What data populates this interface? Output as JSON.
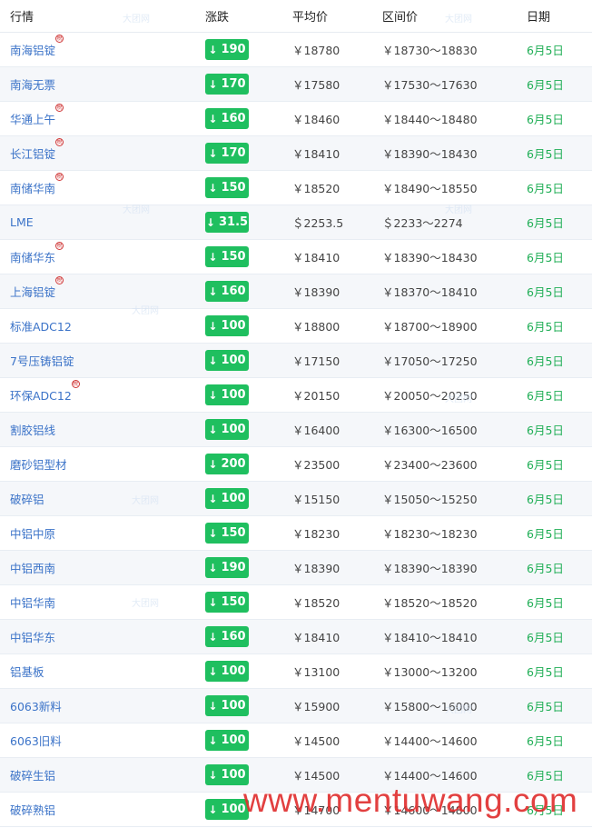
{
  "headers": {
    "name": "行情",
    "change": "涨跌",
    "avg": "平均价",
    "range": "区间价",
    "date": "日期"
  },
  "badge_glyph": "税",
  "arrow_glyph": "↓",
  "watermark_text": "www.mentuwang.com",
  "faint_logo_text": "大团网",
  "colors": {
    "up_down_pill": "#1fbf5f",
    "date_text": "#1fae55",
    "link_text": "#3b73c8",
    "watermark": "#e03030"
  },
  "rows": [
    {
      "name": "南海铝锭",
      "badge": true,
      "change": "190",
      "avg": "￥18780",
      "range": "￥18730～18830",
      "date": "6月5日"
    },
    {
      "name": "南海无票",
      "badge": false,
      "change": "170",
      "avg": "￥17580",
      "range": "￥17530～17630",
      "date": "6月5日"
    },
    {
      "name": "华通上午",
      "badge": true,
      "change": "160",
      "avg": "￥18460",
      "range": "￥18440～18480",
      "date": "6月5日"
    },
    {
      "name": "长江铝锭",
      "badge": true,
      "change": "170",
      "avg": "￥18410",
      "range": "￥18390～18430",
      "date": "6月5日"
    },
    {
      "name": "南储华南",
      "badge": true,
      "change": "150",
      "avg": "￥18520",
      "range": "￥18490～18550",
      "date": "6月5日"
    },
    {
      "name": "LME",
      "badge": false,
      "change": "31.5",
      "avg": "＄2253.5",
      "range": "＄2233～2274",
      "date": "6月5日"
    },
    {
      "name": "南储华东",
      "badge": true,
      "change": "150",
      "avg": "￥18410",
      "range": "￥18390～18430",
      "date": "6月5日"
    },
    {
      "name": "上海铝锭",
      "badge": true,
      "change": "160",
      "avg": "￥18390",
      "range": "￥18370～18410",
      "date": "6月5日"
    },
    {
      "name": "标准ADC12",
      "badge": false,
      "change": "100",
      "avg": "￥18800",
      "range": "￥18700～18900",
      "date": "6月5日"
    },
    {
      "name": "7号压铸铝锭",
      "badge": false,
      "change": "100",
      "avg": "￥17150",
      "range": "￥17050～17250",
      "date": "6月5日"
    },
    {
      "name": "环保ADC12",
      "badge": true,
      "change": "100",
      "avg": "￥20150",
      "range": "￥20050～20250",
      "date": "6月5日"
    },
    {
      "name": "割胶铝线",
      "badge": false,
      "change": "100",
      "avg": "￥16400",
      "range": "￥16300～16500",
      "date": "6月5日"
    },
    {
      "name": "磨砂铝型材",
      "badge": false,
      "change": "200",
      "avg": "￥23500",
      "range": "￥23400～23600",
      "date": "6月5日"
    },
    {
      "name": "破碎铝",
      "badge": false,
      "change": "100",
      "avg": "￥15150",
      "range": "￥15050～15250",
      "date": "6月5日"
    },
    {
      "name": "中铝中原",
      "badge": false,
      "change": "150",
      "avg": "￥18230",
      "range": "￥18230～18230",
      "date": "6月5日"
    },
    {
      "name": "中铝西南",
      "badge": false,
      "change": "190",
      "avg": "￥18390",
      "range": "￥18390～18390",
      "date": "6月5日"
    },
    {
      "name": "中铝华南",
      "badge": false,
      "change": "150",
      "avg": "￥18520",
      "range": "￥18520～18520",
      "date": "6月5日"
    },
    {
      "name": "中铝华东",
      "badge": false,
      "change": "160",
      "avg": "￥18410",
      "range": "￥18410～18410",
      "date": "6月5日"
    },
    {
      "name": "铝基板",
      "badge": false,
      "change": "100",
      "avg": "￥13100",
      "range": "￥13000～13200",
      "date": "6月5日"
    },
    {
      "name": "6063新料",
      "badge": false,
      "change": "100",
      "avg": "￥15900",
      "range": "￥15800～16000",
      "date": "6月5日"
    },
    {
      "name": "6063旧料",
      "badge": false,
      "change": "100",
      "avg": "￥14500",
      "range": "￥14400～14600",
      "date": "6月5日"
    },
    {
      "name": "破碎生铝",
      "badge": false,
      "change": "100",
      "avg": "￥14500",
      "range": "￥14400～14600",
      "date": "6月5日"
    },
    {
      "name": "破碎熟铝",
      "badge": false,
      "change": "100",
      "avg": "￥14700",
      "range": "￥14600～14800",
      "date": "6月5日"
    }
  ]
}
